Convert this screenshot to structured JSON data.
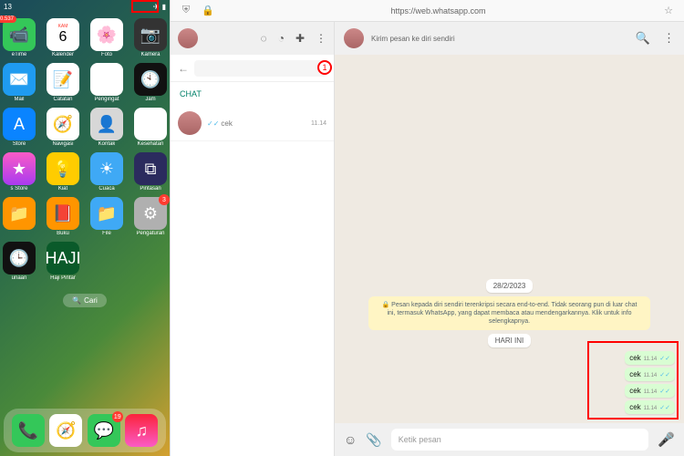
{
  "ios": {
    "time": "13",
    "badge_left": "0.537",
    "apps": [
      {
        "label": "eTime",
        "color": "#34c759",
        "glyph": "📹"
      },
      {
        "label": "Kalender",
        "type": "cal",
        "dow": "KAM",
        "num": "6"
      },
      {
        "label": "Foto",
        "color": "#fff",
        "glyph": "🌸"
      },
      {
        "label": "Kamera",
        "color": "#333",
        "glyph": "📷"
      },
      {
        "label": "Mail",
        "color": "#1f9bf0",
        "glyph": "✉️"
      },
      {
        "label": "Catatan",
        "color": "#fff",
        "glyph": "📝"
      },
      {
        "label": "Pengingat",
        "color": "#fff",
        "glyph": "☑"
      },
      {
        "label": "Jam",
        "color": "#111",
        "glyph": "🕙"
      },
      {
        "label": "Store",
        "color": "#0a84ff",
        "glyph": "A"
      },
      {
        "label": "Navigasi",
        "color": "#fff",
        "glyph": "🧭"
      },
      {
        "label": "Kontak",
        "color": "#d7d7d7",
        "glyph": "👤"
      },
      {
        "label": "Kesehatan",
        "color": "#fff",
        "glyph": "❤"
      },
      {
        "label": "s Store",
        "color": "linear-gradient(#fb5bc6,#a83bf0)",
        "glyph": "★"
      },
      {
        "label": "Kiat",
        "color": "#ffcc00",
        "glyph": "💡"
      },
      {
        "label": "Cuaca",
        "color": "#3fa9f5",
        "glyph": "☀"
      },
      {
        "label": "Pintasan",
        "color": "#2b2b5e",
        "glyph": "⧉"
      },
      {
        "label": "",
        "color": "#ff9500",
        "glyph": "📁"
      },
      {
        "label": "Buku",
        "color": "#ff9500",
        "glyph": "📕"
      },
      {
        "label": "File",
        "color": "#3fa9f5",
        "glyph": "📁"
      },
      {
        "label": "Pengaturan",
        "color": "#b0b0b0",
        "glyph": "⚙",
        "badge": "3"
      },
      {
        "label": "unaan",
        "color": "#111",
        "glyph": "🕒"
      },
      {
        "label": "Haji Pintar",
        "color": "#0a5a2a",
        "glyph": "HAJI"
      }
    ],
    "search_label": "Cari",
    "dock": [
      {
        "color": "#34c759",
        "glyph": "📞"
      },
      {
        "color": "#fff",
        "glyph": "🧭"
      },
      {
        "color": "#34c759",
        "glyph": "💬",
        "badge": "19"
      },
      {
        "color": "linear-gradient(#fb233b,#fb5bc6)",
        "glyph": "♫"
      }
    ]
  },
  "browser": {
    "url": "https://web.whatsapp.com"
  },
  "wa": {
    "sidebar": {
      "chat_label": "CHAT",
      "annotation": "1",
      "row": {
        "msg": "cek",
        "time": "11.14"
      }
    },
    "conv": {
      "subtitle": "Kirim pesan ke diri sendiri",
      "date": "28/2/2023",
      "encryption": "🔒 Pesan kepada diri sendiri terenkripsi secara end-to-end. Tidak seorang pun di luar chat ini, termasuk WhatsApp, yang dapat membaca atau mendengarkannya. Klik untuk info selengkapnya.",
      "today": "HARI INI",
      "messages": [
        {
          "text": "cek",
          "time": "11.14"
        },
        {
          "text": "cek",
          "time": "11.14"
        },
        {
          "text": "cek",
          "time": "11.14"
        },
        {
          "text": "cek",
          "time": "11.14"
        }
      ],
      "placeholder": "Ketik pesan"
    }
  }
}
